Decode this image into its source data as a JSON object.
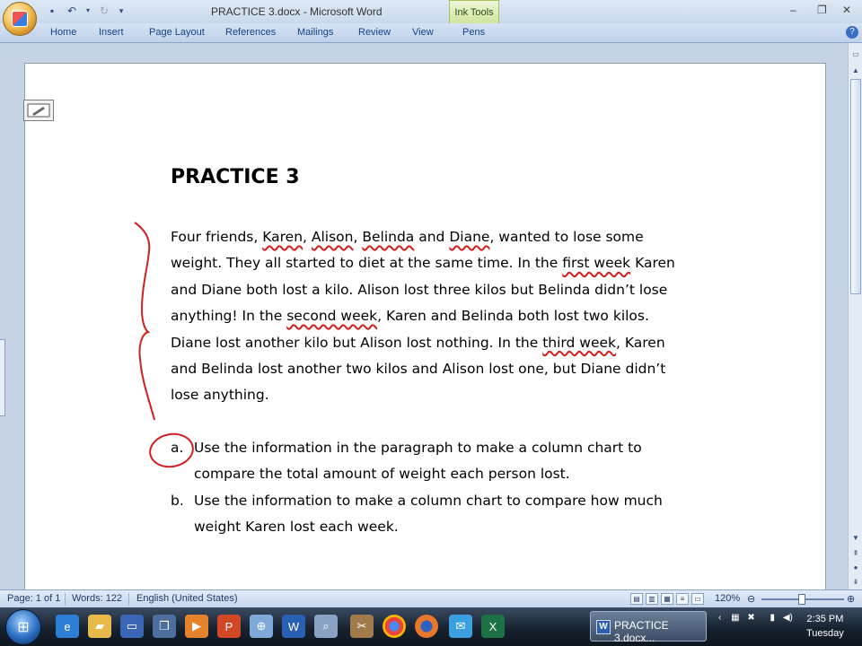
{
  "window": {
    "title": "PRACTICE 3.docx - Microsoft Word",
    "contextual_tab_group": "Ink Tools"
  },
  "ribbon": {
    "tabs": [
      "Home",
      "Insert",
      "Page Layout",
      "References",
      "Mailings",
      "Review",
      "View",
      "Pens"
    ]
  },
  "document": {
    "title": "PRACTICE 3",
    "paragraph_lines": [
      [
        "Four friends, ",
        {
          "u": "Karen"
        },
        ", ",
        {
          "u": "Alison"
        },
        ", ",
        {
          "u": "Belinda"
        },
        " and ",
        {
          "u": "Diane"
        },
        ", wanted to lose some"
      ],
      [
        "weight. They all started to diet at the same time. In the ",
        {
          "u": "first week"
        },
        " Karen"
      ],
      [
        "and Diane both lost a kilo. Alison lost three kilos but Belinda didn’t lose"
      ],
      [
        "anything! In the ",
        {
          "u": "second week"
        },
        ", Karen and Belinda both lost two kilos."
      ],
      [
        "Diane lost another kilo but Alison lost nothing. In the ",
        {
          "u": "third week"
        },
        ", Karen"
      ],
      [
        "and Belinda lost another two kilos and Alison lost one, but Diane didn’t"
      ],
      [
        "lose anything."
      ]
    ],
    "list": [
      {
        "marker": "a.",
        "lines": [
          "Use the information in the paragraph to make a column chart to",
          "compare the total amount of weight each person lost."
        ]
      },
      {
        "marker": "b.",
        "lines": [
          "Use the information to make a column chart to compare how much",
          "weight Karen lost each week."
        ]
      }
    ]
  },
  "status": {
    "page": "Page: 1 of 1",
    "words": "Words: 122",
    "language": "English (United States)",
    "zoom": "120%"
  },
  "taskbar": {
    "active_task": "PRACTICE 3.docx...",
    "time": "2:35 PM",
    "day": "Tuesday"
  },
  "colors": {
    "ink": "#d21f1f",
    "ribbon_text": "#15428b"
  }
}
